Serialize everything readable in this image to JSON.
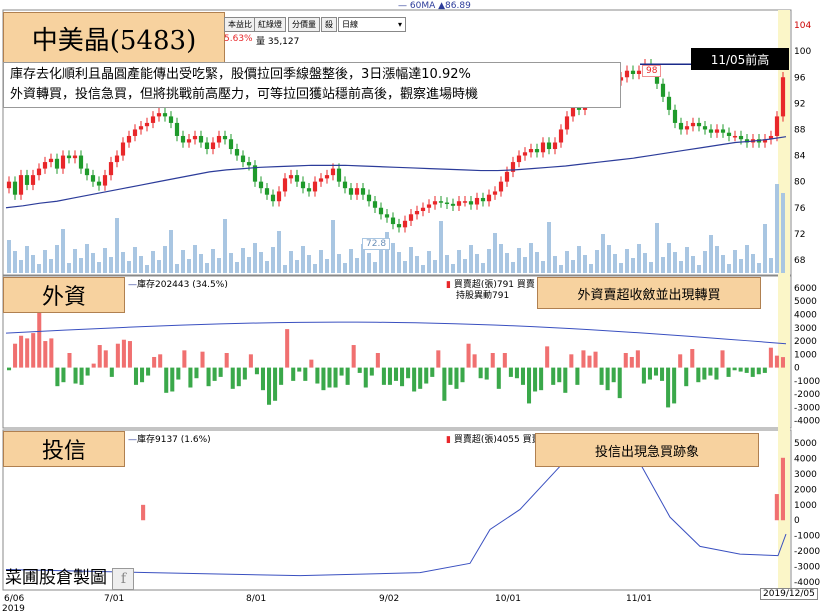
{
  "header": {
    "ma_legend": "60MA ▲86.89",
    "stock_title": "中美晶(5483)",
    "change_pct": "5.63%",
    "volume_text": "量 35,127",
    "toolbar": {
      "btn1": "本益比",
      "btn2": "紅綠燈",
      "btn3": "分價量",
      "btn4": "殺",
      "period": "日線"
    }
  },
  "notes": {
    "line1": "庫存去化順利且晶圓產能傳出受吃緊，股價拉回季線盤整後，3日漲幅達10.92%",
    "line2": "外資轉買，投信急買，但將挑戰前高壓力，可等拉回獲站穩前高後，觀察進場時機"
  },
  "labels": {
    "prev_high": "11/05前高",
    "peak_marker": "98",
    "low_marker": "72.8",
    "foreign_title": "外資",
    "foreign_inventory": "庫存202443 (34.5%)",
    "foreign_legend": "買賣超(張)791 買賣",
    "foreign_legend2": "持股異動791",
    "foreign_callout": "外資賣超收斂並出現轉買",
    "trust_title": "投信",
    "trust_inventory": "庫存9137 (1.6%)",
    "trust_legend": "買賣超(張)4055 買賣",
    "trust_callout": "投信出現急買跡象",
    "watermark": "菜圃股倉製圖",
    "date_label": "2019/12/05"
  },
  "colors": {
    "up": "#e8272a",
    "down": "#1f9a2b",
    "ma": "#2c3c9a",
    "volume": "#a9c6e2",
    "callout": "#f7d29f"
  },
  "chart_data": [
    {
      "type": "candlestick",
      "title": "中美晶(5483)",
      "x_ticks": [
        "6/06\n2019",
        "7/01",
        "8/01",
        "9/02",
        "10/01",
        "11/01"
      ],
      "y_ticks": [
        68,
        72,
        76,
        80,
        84,
        88,
        92,
        96,
        100,
        104
      ],
      "ylim": [
        66,
        106
      ],
      "closes": [
        80,
        78,
        81,
        79.5,
        81,
        82,
        83,
        83.5,
        82,
        84,
        83.6,
        84,
        82,
        81,
        80,
        79.4,
        81,
        83,
        84,
        86,
        87,
        88,
        88.5,
        89,
        90,
        90.5,
        90,
        89,
        87,
        86,
        86.5,
        87,
        86,
        85,
        86,
        87,
        86.5,
        85,
        84,
        83,
        82.5,
        80,
        79,
        78,
        77,
        78.5,
        80.5,
        81,
        80,
        79,
        78.5,
        80,
        80.5,
        81,
        82,
        80,
        79,
        78,
        79,
        78,
        77,
        76,
        75,
        74.5,
        73.5,
        73,
        74,
        75,
        75.5,
        76,
        76.5,
        77,
        76.8,
        76.6,
        76.3,
        77,
        77,
        76.5,
        77.5,
        77,
        78,
        78.5,
        80,
        81.5,
        83,
        84,
        84.5,
        85,
        84.5,
        86,
        85,
        86,
        88,
        90,
        92,
        91,
        92.5,
        93,
        94,
        94.5,
        95,
        95.5,
        96,
        97,
        96.5,
        97,
        98,
        97,
        95,
        93,
        91,
        89,
        88,
        88.5,
        89,
        88.5,
        88,
        87.5,
        88,
        87.5,
        87,
        87,
        86.5,
        86,
        86.5,
        86,
        86.5,
        87,
        90,
        96
      ],
      "ma60": [
        76,
        76.3,
        76.7,
        77,
        77.5,
        78,
        78.5,
        79,
        79.5,
        80,
        80.5,
        81,
        81.5,
        81.8,
        82,
        82.2,
        82.3,
        82.4,
        82.5,
        82.5,
        82.5,
        82.4,
        82.3,
        82.2,
        82.1,
        82,
        81.9,
        81.8,
        81.7,
        81.7,
        81.8,
        82,
        82.2,
        82.4,
        82.7,
        83,
        83.3,
        83.6,
        84,
        84.4,
        84.8,
        85.2,
        85.6,
        86,
        86.2,
        86.5,
        86.89
      ],
      "volume_scale": "relative",
      "annotations": [
        "98",
        "72.8",
        "11/05前高"
      ]
    },
    {
      "type": "bar",
      "title": "外資",
      "series": [
        {
          "name": "買賣超(張)",
          "values": [
            -200,
            1800,
            2400,
            2200,
            2600,
            5100,
            2000,
            2200,
            -1400,
            -1100,
            1100,
            -1200,
            -1300,
            -600,
            300,
            1700,
            1300,
            -700,
            1800,
            2100,
            2000,
            -1300,
            -1100,
            -600,
            800,
            1000,
            -1900,
            -1800,
            -900,
            1300,
            -1500,
            -800,
            1200,
            -1400,
            -1000,
            -700,
            1100,
            -1600,
            -1400,
            -900,
            1000,
            -500,
            -1700,
            -2800,
            -2500,
            -1300,
            2900,
            -1000,
            -300,
            -1000,
            600,
            -1200,
            -1700,
            -1500,
            -1500,
            -600,
            -1300,
            1700,
            -400,
            -1500,
            -600,
            1100,
            -1300,
            -1300,
            -1000,
            -1400,
            -800,
            -1800,
            -1600,
            -1200,
            -700,
            1300,
            -2500,
            -1300,
            -1600,
            -1100,
            1800,
            1000,
            -800,
            -900,
            1100,
            -1600,
            1100,
            -700,
            -800,
            -1300,
            -2700,
            -1800,
            -1700,
            1600,
            -1300,
            -1100,
            -1900,
            1000,
            -1300,
            1300,
            900,
            1200,
            -1300,
            -1700,
            -1100,
            -2300,
            1100,
            800,
            1300,
            -1200,
            -900,
            -600,
            -1000,
            -3000,
            -2700,
            1000,
            -1400,
            1400,
            -1100,
            -900,
            -600,
            -900,
            1300,
            -700,
            -200,
            -300,
            -400,
            -700,
            -500,
            -400,
            1500,
            900,
            791
          ]
        }
      ],
      "inventory_line": "庫存",
      "y_ticks": [
        6000,
        5000,
        4000,
        3000,
        2000,
        1000,
        0,
        -1000,
        -2000,
        -3000,
        -4000
      ],
      "ylim": [
        -4400,
        6600
      ]
    },
    {
      "type": "bar",
      "title": "投信",
      "series": [
        {
          "name": "買賣超(張)",
          "values": [
            0,
            0,
            0,
            0,
            0,
            0,
            0,
            0,
            0,
            0,
            0,
            0,
            0,
            0,
            0,
            0,
            0,
            0,
            0,
            0,
            0,
            0,
            1000,
            0,
            0,
            0,
            0,
            0,
            0,
            0,
            0,
            0,
            0,
            0,
            0,
            0,
            0,
            0,
            0,
            0,
            0,
            0,
            0,
            0,
            0,
            0,
            0,
            0,
            0,
            0,
            0,
            0,
            0,
            0,
            0,
            0,
            0,
            0,
            0,
            0,
            0,
            0,
            0,
            0,
            0,
            0,
            0,
            0,
            0,
            0,
            0,
            0,
            0,
            0,
            0,
            0,
            0,
            0,
            0,
            0,
            0,
            0,
            0,
            0,
            0,
            0,
            0,
            0,
            0,
            0,
            0,
            0,
            0,
            0,
            0,
            0,
            0,
            0,
            0,
            0,
            0,
            0,
            0,
            0,
            0,
            0,
            0,
            0,
            0,
            0,
            0,
            0,
            0,
            0,
            0,
            0,
            0,
            0,
            0,
            0,
            0,
            0,
            0,
            0,
            0,
            0,
            1700,
            4055
          ]
        }
      ],
      "inventory_line": "庫存",
      "y_ticks": [
        5000,
        4000,
        3000,
        2000,
        1000,
        0,
        -1000,
        -2000,
        -3000,
        -4000
      ],
      "ylim": [
        -4400,
        5600
      ]
    }
  ]
}
